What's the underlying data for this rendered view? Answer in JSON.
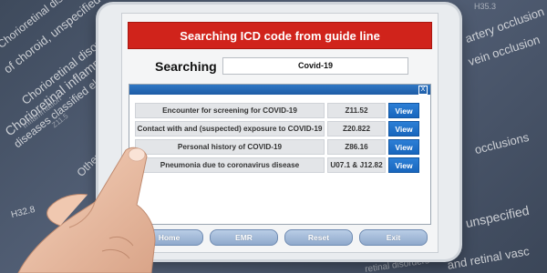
{
  "background_text": [
    "Other chorioretinal",
    "Chorioretinal inflammation",
    "diseases classified elsewhere",
    "Chorioretinal disorders in",
    "of choroid, unspecified",
    "Inflammation",
    "Chorioretinal disorders",
    "artery occlusion",
    "vein occlusion",
    "occlusions",
    "unspecified",
    "and retinal vasc",
    "retinal disorders",
    "H32.8",
    "H35.3",
    "Z11.5"
  ],
  "app": {
    "title": "Searching ICD code from guide line",
    "search_label": "Searching",
    "search_value": "Covid-19",
    "close_symbol": "X"
  },
  "results": [
    {
      "description": "Encounter for screening for COVID-19",
      "code": "Z11.52",
      "action": "View"
    },
    {
      "description": "Contact with and (suspected) exposure to COVID-19",
      "code": "Z20.822",
      "action": "View"
    },
    {
      "description": "Personal history of COVID-19",
      "code": "Z86.16",
      "action": "View"
    },
    {
      "description": "Pneumonia due to coronavirus disease",
      "code": "U07.1 & J12.82",
      "action": "View"
    }
  ],
  "nav": {
    "home": "Home",
    "emr": "EMR",
    "reset": "Reset",
    "exit": "Exit"
  },
  "colors": {
    "title_red": "#d0231b",
    "view_blue": "#1866bd",
    "panel_header_blue": "#1e5ca6"
  }
}
